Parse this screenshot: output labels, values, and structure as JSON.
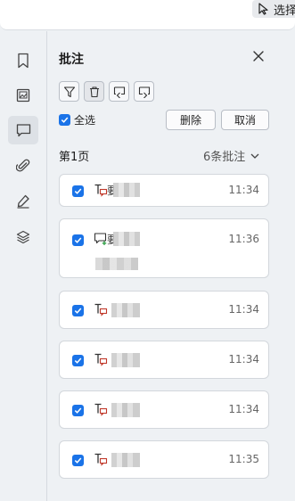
{
  "toolbar": {
    "select_label": "选择"
  },
  "rail": {
    "items": [
      {
        "icon": "bookmark-icon"
      },
      {
        "icon": "image-icon"
      },
      {
        "icon": "comment-icon",
        "active": true
      },
      {
        "icon": "attachment-icon"
      },
      {
        "icon": "signature-pen-icon"
      },
      {
        "icon": "layers-icon"
      }
    ]
  },
  "panel": {
    "title": "批注",
    "select_all_label": "全选",
    "delete_label": "删除",
    "cancel_label": "取消",
    "page_label": "第1页",
    "count_label": "6条批注"
  },
  "annotations": [
    {
      "type": "text-comment",
      "time": "11:34",
      "author_visible": "要"
    },
    {
      "type": "note-add",
      "time": "11:36",
      "author_visible": "要"
    },
    {
      "type": "text-comment",
      "time": "11:34",
      "author_visible": ""
    },
    {
      "type": "text-comment",
      "time": "11:34",
      "author_visible": ""
    },
    {
      "type": "text-comment",
      "time": "11:34",
      "author_visible": ""
    },
    {
      "type": "text-comment",
      "time": "11:35",
      "author_visible": ""
    }
  ],
  "colors": {
    "accent": "#1a73e8",
    "comment_mark": "#c0392b",
    "note_plus": "#2e9e44"
  }
}
